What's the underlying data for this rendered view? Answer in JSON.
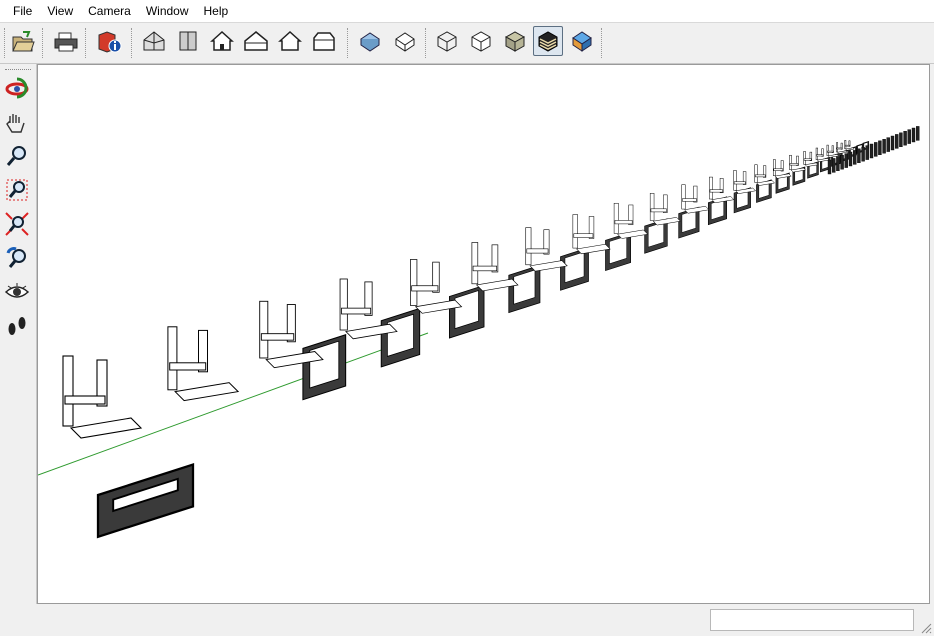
{
  "menu": [
    {
      "label": "File"
    },
    {
      "label": "View"
    },
    {
      "label": "Camera"
    },
    {
      "label": "Window"
    },
    {
      "label": "Help"
    }
  ],
  "toolbar": {
    "buttons": [
      {
        "name": "open-file-icon"
      },
      {
        "name": "print-icon"
      },
      {
        "name": "model-info-icon"
      },
      {
        "name": "iso-view-icon"
      },
      {
        "name": "top-view-icon"
      },
      {
        "name": "front-view-icon"
      },
      {
        "name": "right-view-icon"
      },
      {
        "name": "back-view-icon"
      },
      {
        "name": "left-view-icon"
      },
      {
        "name": "perspective-icon"
      },
      {
        "name": "xray-icon"
      },
      {
        "name": "wireframe-icon"
      },
      {
        "name": "hidden-line-icon"
      },
      {
        "name": "shaded-icon"
      },
      {
        "name": "shaded-textures-icon"
      },
      {
        "name": "monochrome-icon"
      }
    ],
    "active_button": "shaded-textures-icon"
  },
  "left_tools": [
    {
      "name": "orbit-icon"
    },
    {
      "name": "pan-icon"
    },
    {
      "name": "zoom-icon"
    },
    {
      "name": "zoom-window-icon"
    },
    {
      "name": "zoom-extents-icon"
    },
    {
      "name": "previous-view-icon"
    },
    {
      "name": "look-around-icon"
    },
    {
      "name": "walk-icon"
    }
  ],
  "status": {
    "measurements_value": ""
  },
  "colors": {
    "axis_green": "#2e9a2e",
    "chair_dark": "#3a3a3a",
    "chair_light": "#ffffff",
    "outline": "#000000"
  }
}
